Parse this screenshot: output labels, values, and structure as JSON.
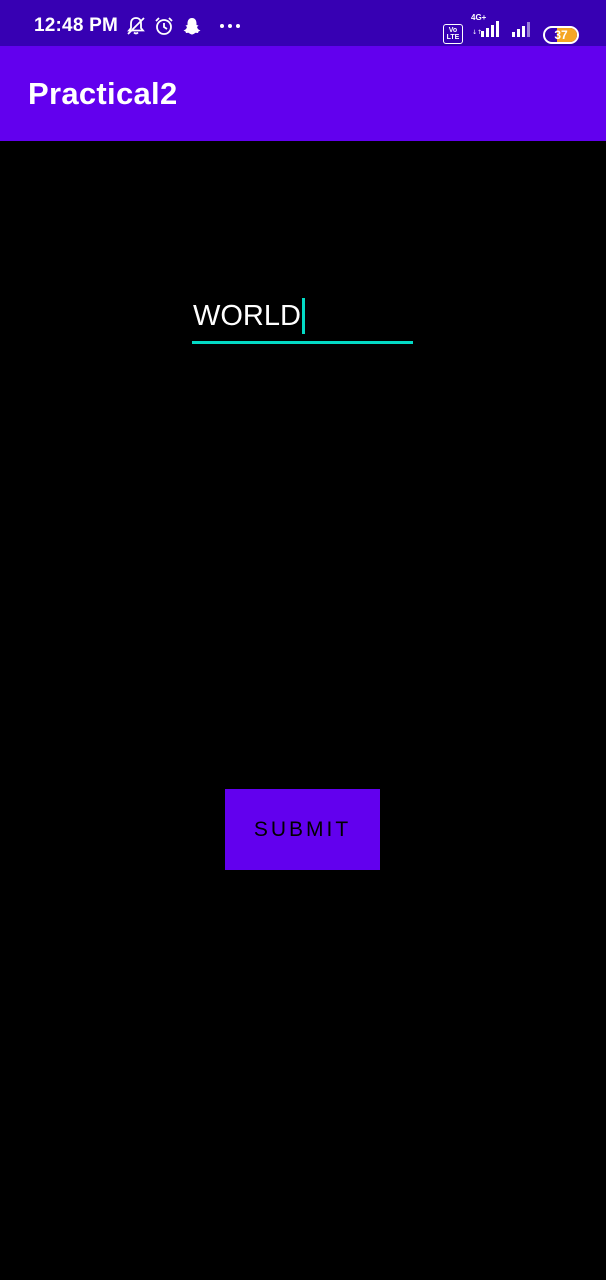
{
  "status_bar": {
    "time": "12:48 PM",
    "left_icons": [
      "notifications-off-icon",
      "alarm-icon",
      "snapchat-icon",
      "more-dots-icon"
    ],
    "volte_label": "Vo LTE",
    "network_label": "4G+",
    "battery_level": "37",
    "battery_fraction": 0.37,
    "background_color": "#3700B3"
  },
  "app_bar": {
    "title": "Practical2",
    "background_color": "#6200EE"
  },
  "input": {
    "value": "WORLD",
    "accent_color": "#03DAC5"
  },
  "button": {
    "label": "SUBMIT",
    "background_color": "#6200EE"
  }
}
